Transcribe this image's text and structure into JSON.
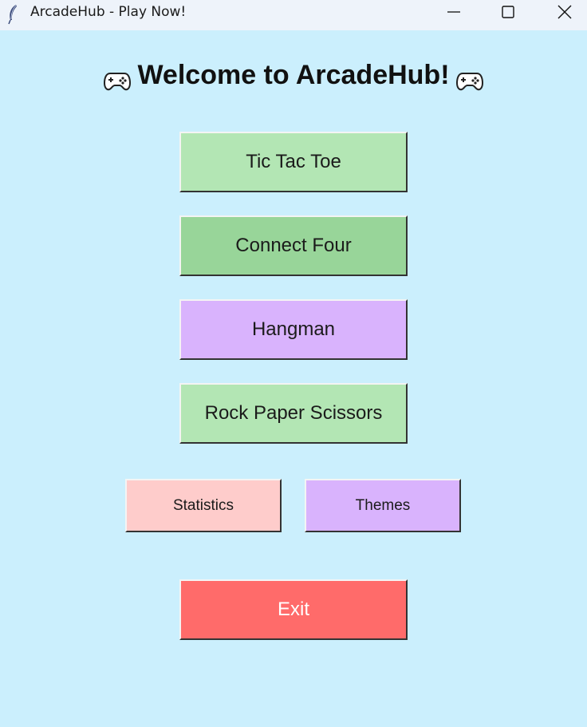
{
  "window": {
    "title": "ArcadeHub - Play Now!",
    "app_icon": "feather-icon",
    "controls": [
      "minimize-icon",
      "maximize-icon",
      "close-icon"
    ]
  },
  "heading": {
    "text": "Welcome to ArcadeHub!",
    "icon": "gamepad-icon"
  },
  "games": {
    "tic_tac_toe": "Tic Tac Toe",
    "connect_four": "Connect Four",
    "hangman": "Hangman",
    "rock_paper_scissors": "Rock Paper Scissors"
  },
  "actions": {
    "statistics": "Statistics",
    "themes": "Themes",
    "exit": "Exit"
  },
  "colors": {
    "background": "#cbeffd",
    "titlebar": "#eef3fa",
    "green_light": "#b3e6b4",
    "green": "#98d599",
    "purple": "#d9b3fd",
    "pink": "#fecccb",
    "red": "#ff6b6a"
  }
}
